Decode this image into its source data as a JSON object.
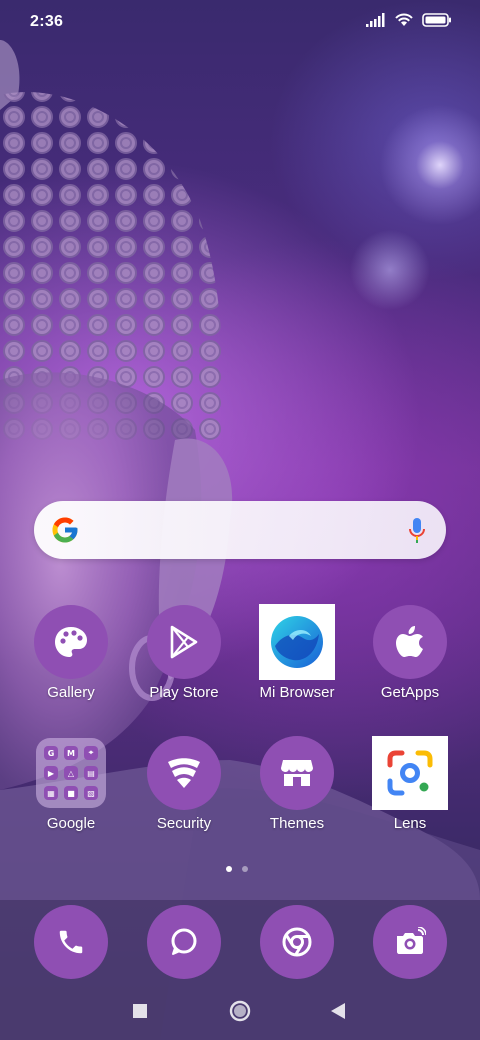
{
  "status_bar": {
    "time": "2:36"
  },
  "search": {
    "provider_icon": "google-g-icon",
    "mic_icon": "microphone-icon"
  },
  "apps": {
    "gallery": {
      "label": "Gallery",
      "icon": "palette-icon"
    },
    "play_store": {
      "label": "Play Store",
      "icon": "play-store-icon"
    },
    "mi_browser": {
      "label": "Mi Browser",
      "icon": "mi-browser-icon"
    },
    "getapps": {
      "label": "GetApps",
      "icon": "apple-icon"
    },
    "google": {
      "label": "Google",
      "icon": "google-folder-icon"
    },
    "security": {
      "label": "Security",
      "icon": "security-shield-icon"
    },
    "themes": {
      "label": "Themes",
      "icon": "store-icon"
    },
    "lens": {
      "label": "Lens",
      "icon": "google-lens-icon"
    }
  },
  "google_folder": {
    "mini_icons": [
      "G",
      "M",
      "⌖",
      "▶",
      "△",
      "▤",
      "▦",
      "■",
      "▧"
    ]
  },
  "page_indicator": {
    "current": 1,
    "total": 2
  },
  "dock": {
    "items": [
      "phone-icon",
      "messages-icon",
      "chrome-icon",
      "camera-icon"
    ]
  },
  "nav": {
    "buttons": [
      "recents-button",
      "home-button",
      "back-button"
    ]
  },
  "colors": {
    "icon_bg": "#8f4fb3",
    "label": "#ffffff"
  }
}
